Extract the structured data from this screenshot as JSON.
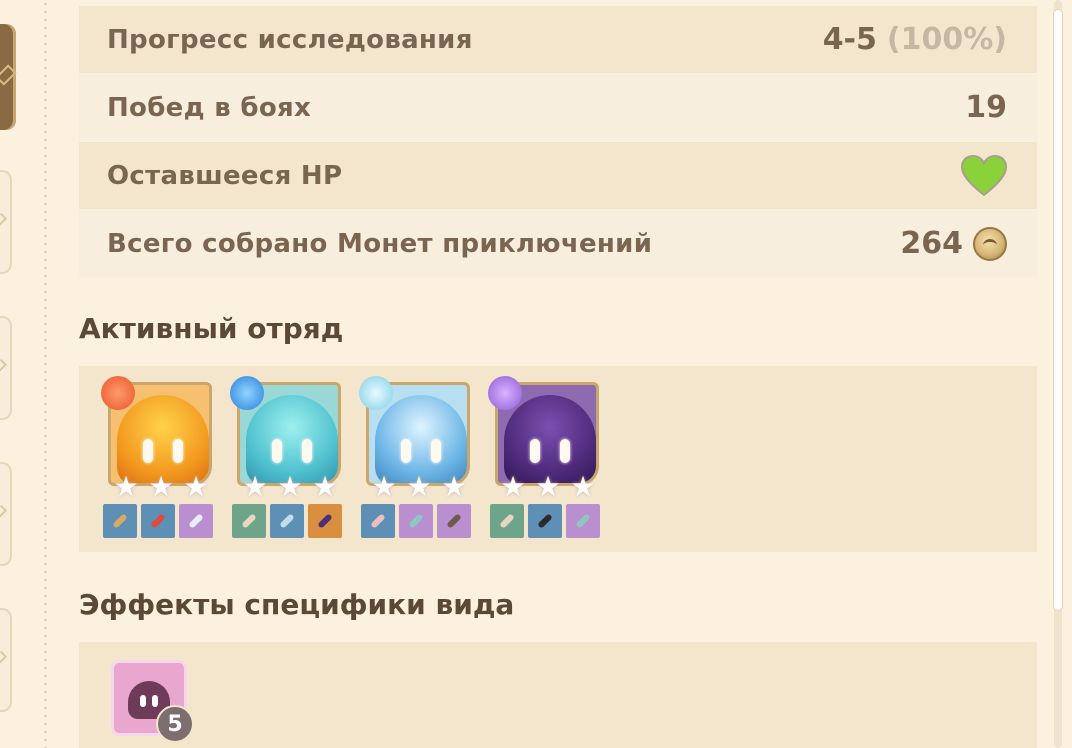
{
  "stats": [
    {
      "label": "Прогресс исследования",
      "value": "4-5",
      "sub": "(100%)"
    },
    {
      "label": "Побед в боях",
      "value": "19"
    },
    {
      "label": "Оставшееся HP",
      "icon": "heart-icon",
      "color": "#8ad13a"
    },
    {
      "label": "Всего собрано Монет приключений",
      "value": "264",
      "icon": "adventure-coin-icon"
    }
  ],
  "team": {
    "title": "Активный отряд",
    "members": [
      {
        "name": "pyro-slime",
        "element": "pyro",
        "stars": 3,
        "body_color": "#f39a20",
        "equipment": [
          "sword-item",
          "feather-item",
          "blade-item"
        ]
      },
      {
        "name": "hydro-slime",
        "element": "hydro",
        "stars": 3,
        "body_color": "#4fc1cf",
        "equipment": [
          "crab-item",
          "book-item",
          "urn-item"
        ]
      },
      {
        "name": "cryo-slime",
        "element": "cryo",
        "stars": 3,
        "body_color": "#6db6e6",
        "equipment": [
          "crab-item",
          "scroll-item",
          "scroll-item"
        ]
      },
      {
        "name": "electro-slime",
        "element": "electro",
        "stars": 3,
        "body_color": "#4f2a7b",
        "equipment": [
          "crab-item",
          "greatsword-item",
          "book-item"
        ]
      }
    ]
  },
  "effects": {
    "title": "Эффекты специфики вида",
    "items": [
      {
        "name": "slime-effect",
        "count": "5",
        "color": "#e9a7cf"
      }
    ]
  }
}
